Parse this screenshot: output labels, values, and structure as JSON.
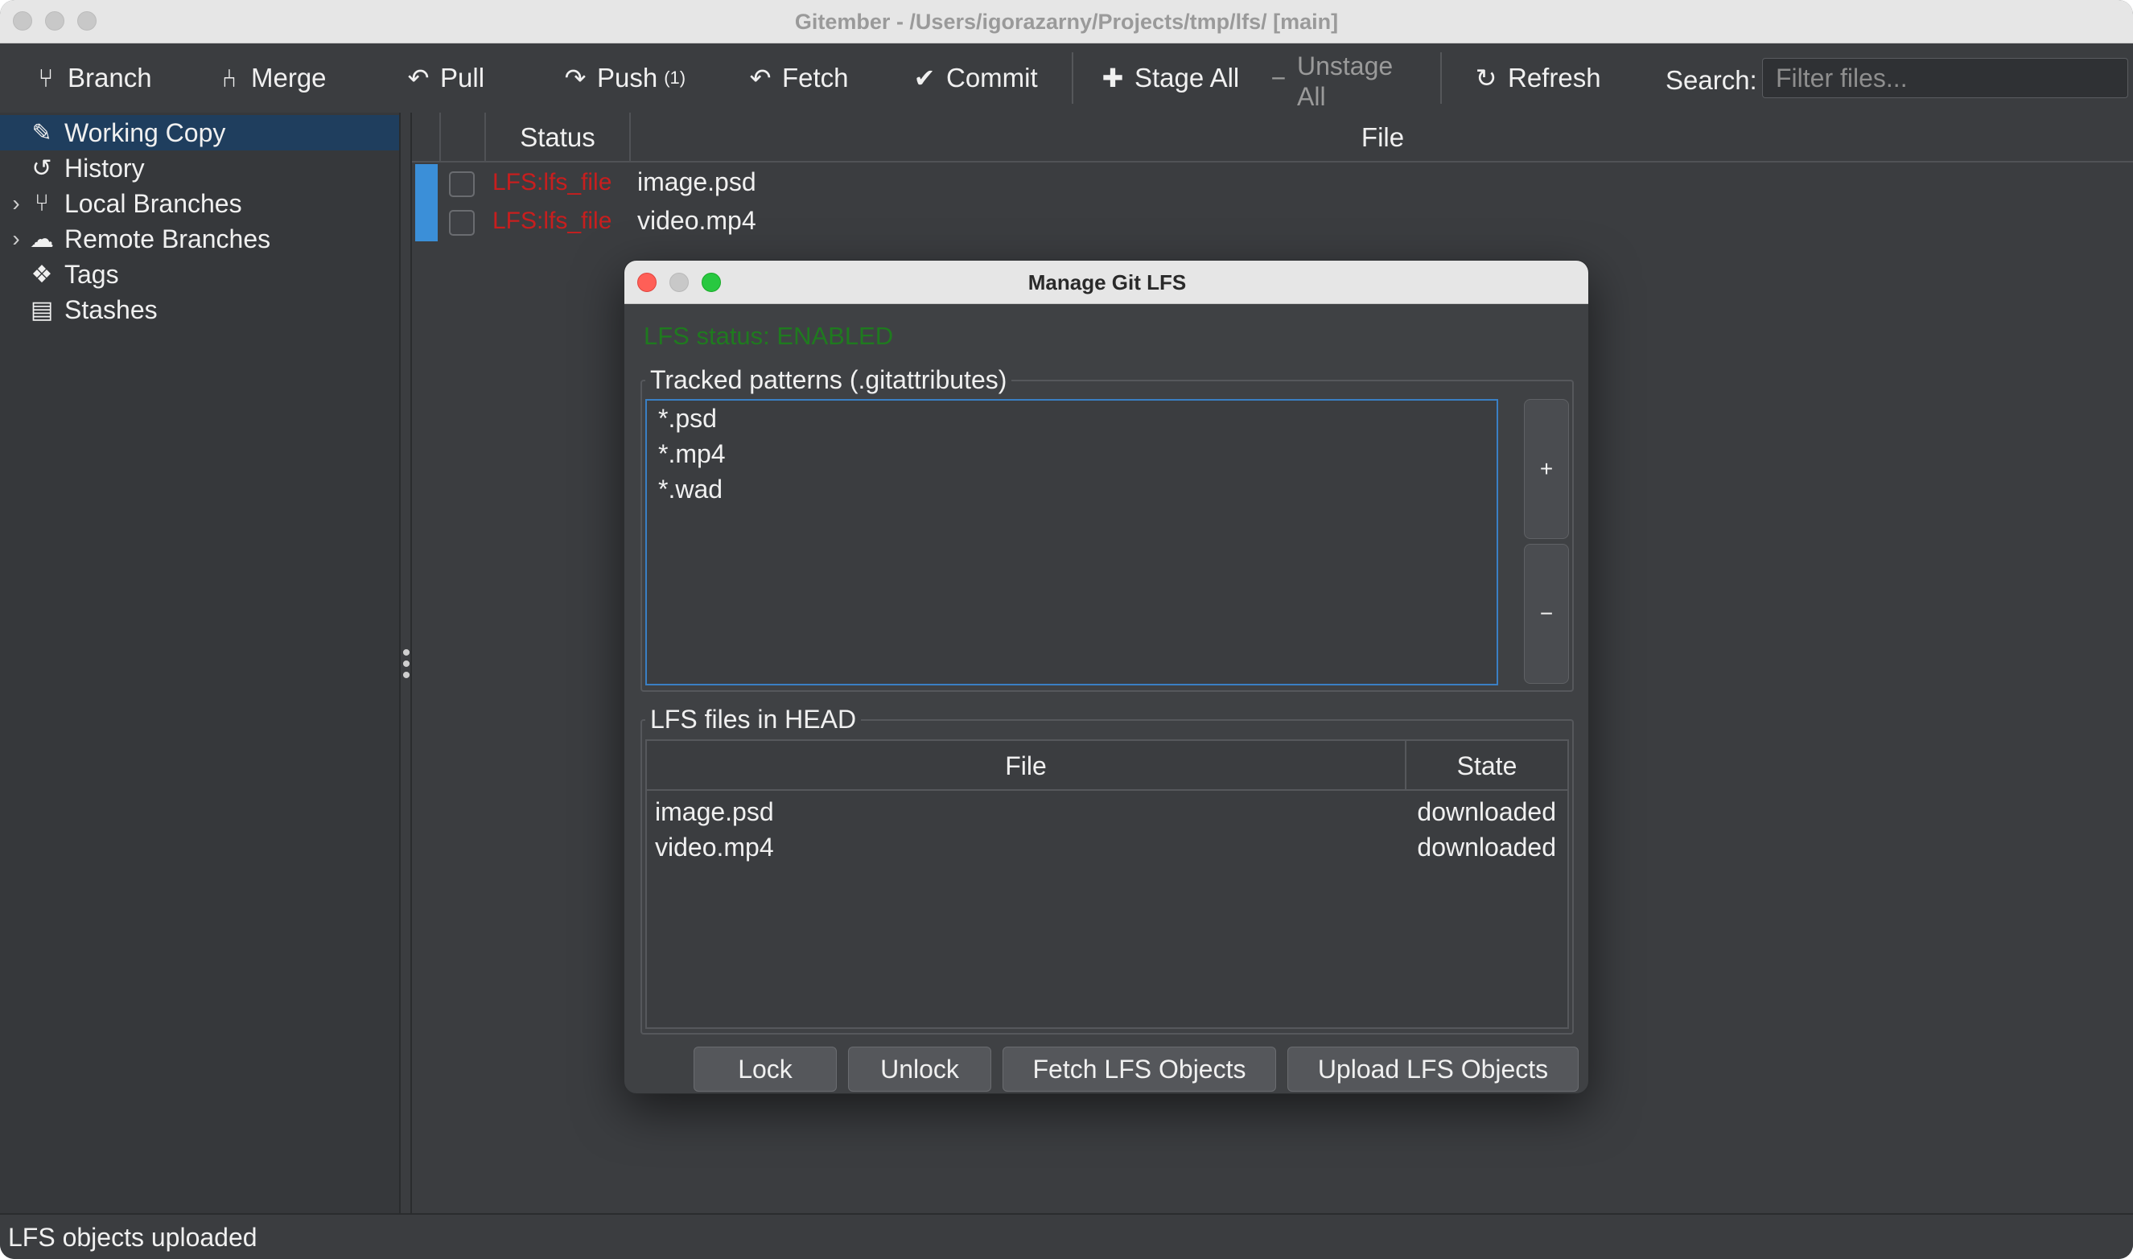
{
  "window": {
    "title": "Gitember - /Users/igorazarny/Projects/tmp/lfs/ [main]"
  },
  "toolbar": {
    "branch": "Branch",
    "merge": "Merge",
    "pull": "Pull",
    "push": "Push",
    "push_count": "(1)",
    "fetch": "Fetch",
    "commit": "Commit",
    "stage_all": "Stage All",
    "unstage_line1": "Unstage",
    "unstage_line2": "All",
    "refresh": "Refresh",
    "search_label": "Search:",
    "search_placeholder": "Filter files...",
    "search_value": ""
  },
  "sidebar": {
    "items": [
      {
        "label": "Working Copy",
        "icon": "edit-icon",
        "selected": true
      },
      {
        "label": "History",
        "icon": "history-icon"
      },
      {
        "label": "Local Branches",
        "icon": "branch-icon",
        "expandable": true
      },
      {
        "label": "Remote Branches",
        "icon": "cloud-icon",
        "expandable": true
      },
      {
        "label": "Tags",
        "icon": "tags-icon"
      },
      {
        "label": "Stashes",
        "icon": "archive-icon"
      }
    ]
  },
  "files": {
    "columns": {
      "status": "Status",
      "file": "File"
    },
    "rows": [
      {
        "status": "LFS:lfs_file",
        "file": "image.psd"
      },
      {
        "status": "LFS:lfs_file",
        "file": "video.mp4"
      }
    ]
  },
  "status_bar": {
    "message": "LFS objects uploaded"
  },
  "dialog": {
    "title": "Manage Git LFS",
    "lfs_status": "LFS status: ENABLED",
    "tracked_label": "Tracked patterns (.gitattributes)",
    "patterns": [
      "*.psd",
      "*.mp4",
      "*.wad"
    ],
    "add_label": "+",
    "remove_label": "−",
    "lfs_files_label": "LFS files in HEAD",
    "lfs_columns": {
      "file": "File",
      "state": "State"
    },
    "lfs_files": [
      {
        "file": "image.psd",
        "state": "downloaded"
      },
      {
        "file": "video.mp4",
        "state": "downloaded"
      }
    ],
    "buttons": {
      "lock": "Lock",
      "unlock": "Unlock",
      "fetch": "Fetch LFS Objects",
      "upload": "Upload LFS Objects"
    }
  },
  "colors": {
    "accent": "#3b8fd8",
    "selection": "#1f3e5e",
    "lfs_status_green": "#1f7a1f",
    "lfs_file_red": "#c81e1e"
  }
}
